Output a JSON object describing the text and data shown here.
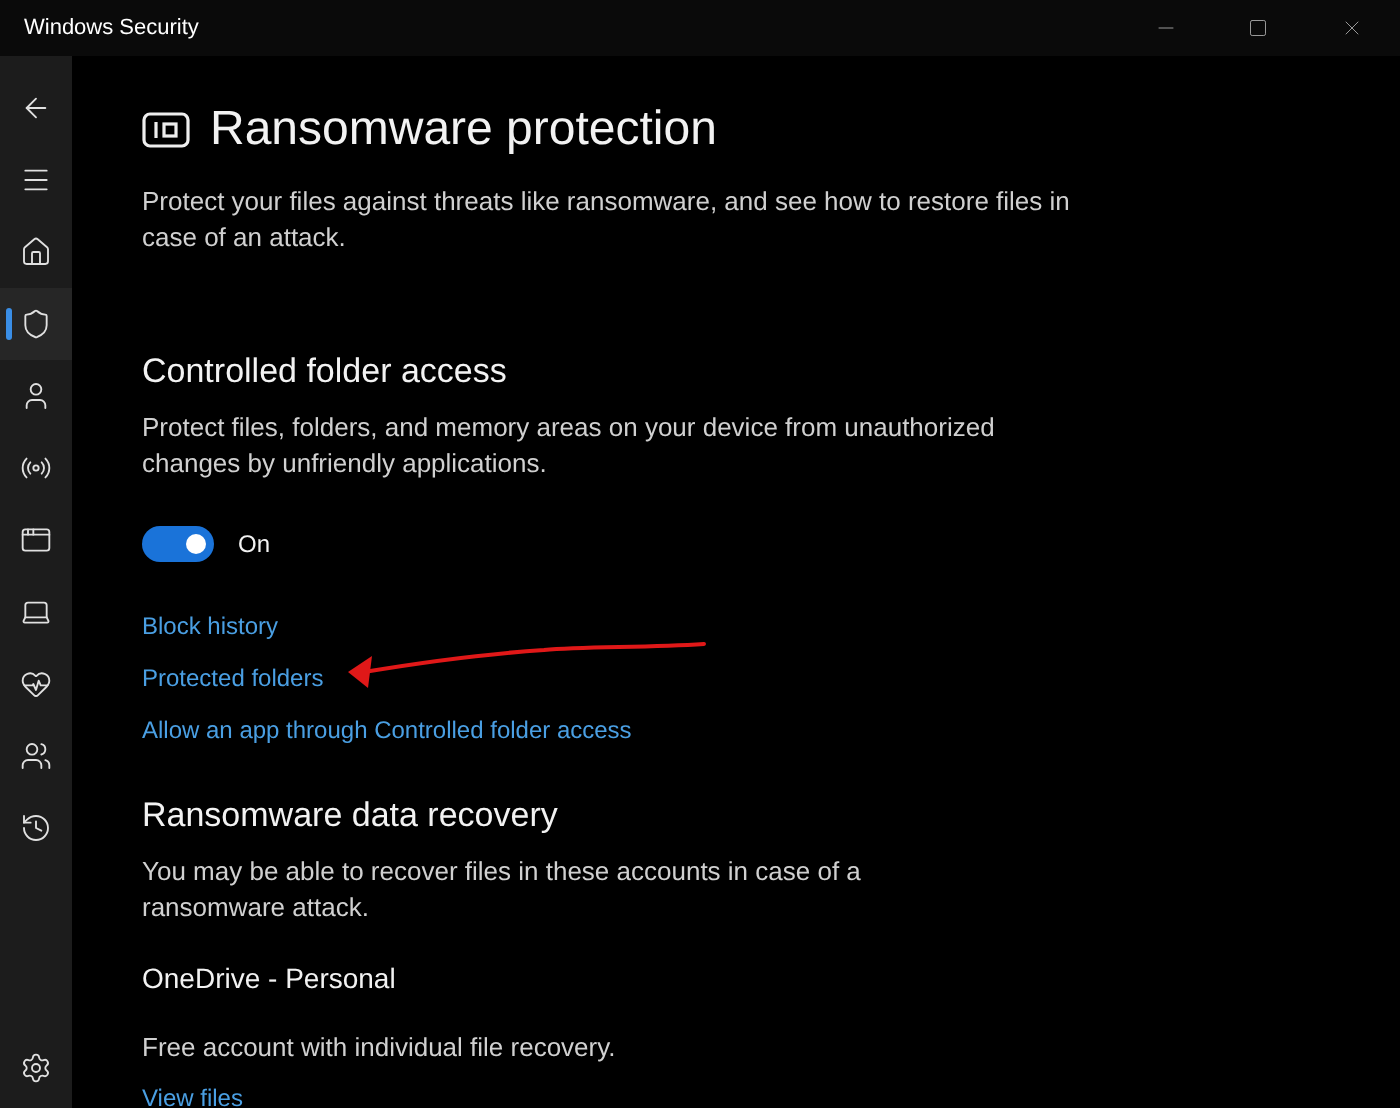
{
  "window": {
    "title": "Windows Security"
  },
  "sidebar": {
    "items": [
      {
        "selected": false
      },
      {
        "selected": false
      },
      {
        "selected": false
      },
      {
        "selected": true
      },
      {
        "selected": false
      },
      {
        "selected": false
      },
      {
        "selected": false
      },
      {
        "selected": false
      },
      {
        "selected": false
      },
      {
        "selected": false
      },
      {
        "selected": false
      }
    ]
  },
  "page": {
    "title": "Ransomware protection",
    "description": "Protect your files against threats like ransomware, and see how to restore files in case of an attack."
  },
  "controlled_folder_access": {
    "heading": "Controlled folder access",
    "description": "Protect files, folders, and memory areas on your device from unauthorized changes by unfriendly applications.",
    "toggle": {
      "on": true,
      "label": "On"
    },
    "links": [
      "Block history",
      "Protected folders",
      "Allow an app through Controlled folder access"
    ]
  },
  "data_recovery": {
    "heading": "Ransomware data recovery",
    "description": "You may be able to recover files in these accounts in case of a ransomware attack.",
    "account": "OneDrive - Personal",
    "account_detail": "Free account with individual file recovery.",
    "link": "View files"
  }
}
